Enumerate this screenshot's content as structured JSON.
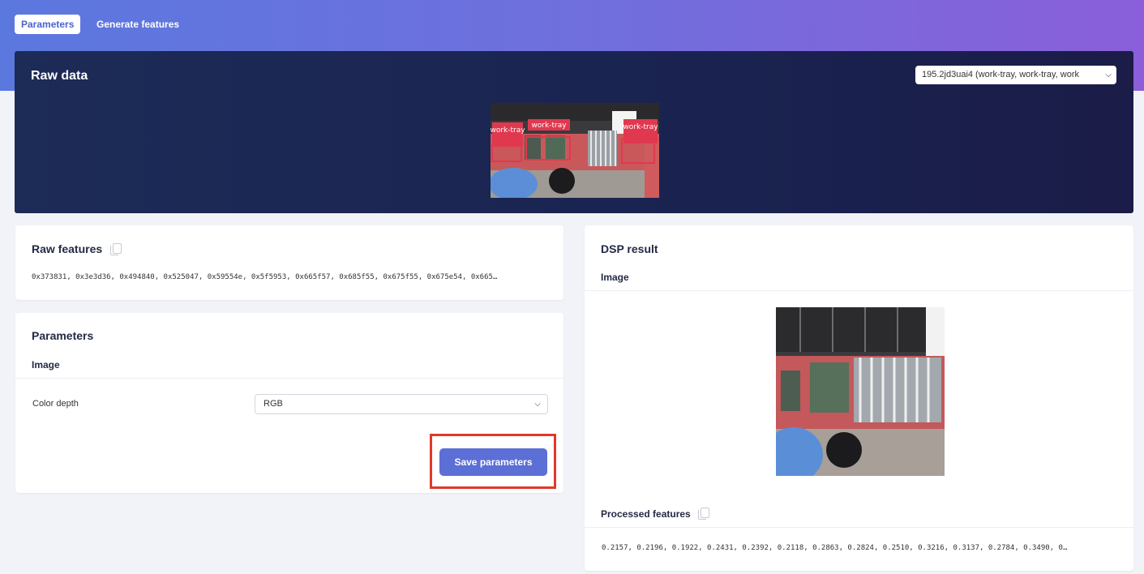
{
  "tabs": [
    {
      "label": "Parameters",
      "active": true
    },
    {
      "label": "Generate features",
      "active": false
    }
  ],
  "raw_data": {
    "title": "Raw data",
    "sample_select_value": "195.2jd3uai4 (work-tray, work-tray, work",
    "bbox_labels": [
      "work-tray",
      "work-tray",
      "work-tray"
    ]
  },
  "raw_features": {
    "title": "Raw features",
    "values": "0x373831, 0x3e3d36, 0x494840, 0x525047, 0x59554e, 0x5f5953, 0x665f57, 0x685f55, 0x675f55, 0x675e54, 0x665…"
  },
  "parameters": {
    "title": "Parameters",
    "section": "Image",
    "color_depth_label": "Color depth",
    "color_depth_value": "RGB",
    "save_label": "Save parameters"
  },
  "dsp_result": {
    "title": "DSP result",
    "section": "Image",
    "processed_title": "Processed features",
    "processed_values": "0.2157, 0.2196, 0.1922, 0.2431, 0.2392, 0.2118, 0.2863, 0.2824, 0.2510, 0.3216, 0.3137, 0.2784, 0.3490, 0…"
  },
  "colors": {
    "accent": "#5b6fd6",
    "bbox_red": "#e0394f",
    "highlight_red": "#e0392a",
    "panel_navy": "#1d2b57"
  },
  "icons": [
    "copy-icon",
    "chevron-down-icon"
  ]
}
